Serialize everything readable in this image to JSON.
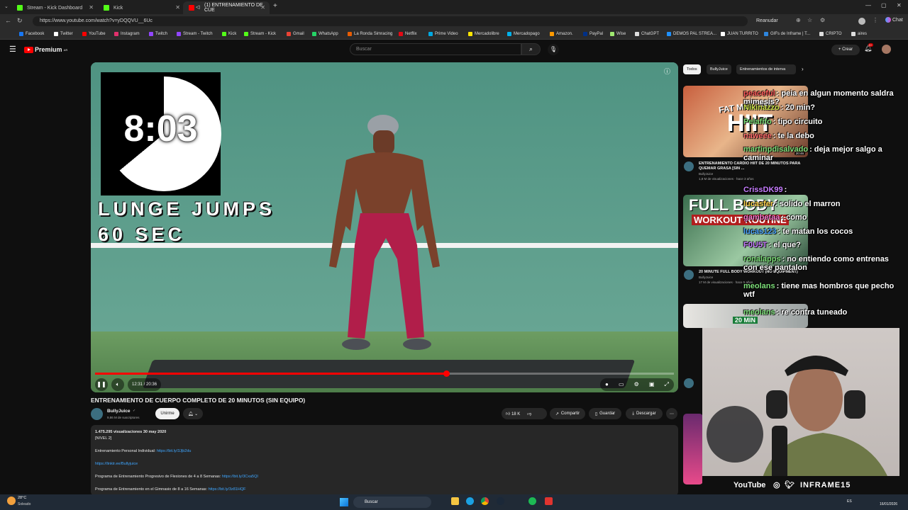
{
  "tabs": [
    {
      "label": "Stream - Kick Dashboard",
      "color": "#53fc18"
    },
    {
      "label": "Kick",
      "color": "#53fc18"
    },
    {
      "label": "(1) ENTRENAMIENTO DE CUE",
      "color": "#ff0000"
    }
  ],
  "address": {
    "url": "https://www.youtube.com/watch?v=yDQQVU__6Uc",
    "resume": "Reanudar",
    "chat": "Chat"
  },
  "bookmarks": [
    "Facebook",
    "Twitter",
    "YouTube",
    "Instagram",
    "Twitch",
    "Stream - Twitch",
    "Kick",
    "Stream - Kick",
    "Gmail",
    "WhatsApp",
    "La Ronda Simracing",
    "Netflix",
    "Prime Video",
    "Mercadolibre",
    "Mercadopago",
    "Amazon.",
    "PayPal",
    "Wise",
    "ChatGPT",
    "DEMOS PAL STREA...",
    "JUAN TURRITO",
    "GIFs de Inframe | T...",
    "CRIPTO",
    "aires"
  ],
  "yt": {
    "logo": "Premium",
    "logo_sup": "AR",
    "search_placeholder": "Buscar",
    "create": "Crear",
    "notif": "9+"
  },
  "player": {
    "timer": "8:03",
    "overlay1": "LUNGE JUMPS",
    "overlay2": "60 SEC",
    "time": "12:31 / 20:36",
    "progress": 0.607
  },
  "video": {
    "title": "ENTRENAMIENTO DE CUERPO COMPLETO DE 20 MINUTOS (SIN EQUIPO)",
    "channel": "BullyJuice",
    "subs": "9,86 M de suscriptores",
    "join": "Unirme",
    "likes": "18 K",
    "share": "Compartir",
    "save": "Guardar",
    "download": "Descargar",
    "views": "1.475.295 visualizaciones  30 may 2020",
    "level": "[NIVEL 2]",
    "desc_lines": [
      {
        "text": "Entrenamiento Personal Individual: ",
        "link": "https://bit.ly/3Jjb2du"
      },
      {
        "text": "",
        "link": "https://linktr.ee/Bullyjuice"
      },
      {
        "text": "Programa de Entrenamiento Progresivo de Flexiones de 4 a 8 Semanas: ",
        "link": "https://bit.ly/3Cxa5QI"
      },
      {
        "text": "Programa de Entrenamiento en el Gimnasio de 8 a 16 Semanas: ",
        "link": "https://bit.ly/3z81HQF"
      }
    ]
  },
  "sidebar": {
    "chips": [
      "Todos",
      "BullyJuice",
      "Entrenamientos de interva"
    ],
    "videos": [
      {
        "thumb_text": "HIIT",
        "thumb_sub": "FAT MELTING",
        "title": "ENTRENAMIENTO CARDIO HIIT DE 20 MINUTOS PARA QUEMAR GRASA [SIN ...",
        "channel": "BullyJuice",
        "meta": "1,8 M de visualizaciones · hace 3 años",
        "duration": "20:46"
      },
      {
        "thumb_text": "FULL BODY",
        "thumb_sub": "WORKOUT ROUTINE",
        "title": "20 MINUTE FULL BODY WORKOUT (NO EQUIPMENT)",
        "channel": "BullyJuice",
        "meta": "17 M de visualizaciones · hace 5 años",
        "duration": ""
      },
      {
        "thumb_text": "20 MIN",
        "thumb_sub": "",
        "title": "",
        "channel": "",
        "meta": "",
        "duration": ""
      }
    ]
  },
  "chat": [
    {
      "user": "peaceful",
      "msg": ": peia en algun momento saldra mimesis?",
      "color": "#ff5a5a"
    },
    {
      "user": "Nikinazzo",
      "msg": ": 20 min?",
      "color": "#c8e04a"
    },
    {
      "user": "Pelafifo",
      "msg": ": tipo circuito",
      "color": "#7ee07a"
    },
    {
      "user": "naweee",
      "msg": ": te la debo",
      "color": "#ff6a6a"
    },
    {
      "user": "martinpdisalvado",
      "msg": ": deja mejor salgo a caminar",
      "color": "#7ee07a"
    },
    {
      "user": "CrissDK99",
      "msg": ":",
      "color": "#c77dff"
    },
    {
      "user": "lucasfer",
      "msg": ": solido el marron",
      "color": "#ffd24a"
    },
    {
      "user": "gambetaa",
      "msg": ": como",
      "color": "#ff7ad0"
    },
    {
      "user": "lucas123",
      "msg": ": te matan los cocos",
      "color": "#4aa3ff"
    },
    {
      "user": "F0U5T",
      "msg": ": el que?",
      "color": "#c77dff"
    },
    {
      "user": "ronalapps",
      "msg": ": no entiendo como entrenas con ese pantalon",
      "color": "#7ee07a"
    },
    {
      "user": "meolans",
      "msg": ": tiene mas hombros que pecho wtf",
      "color": "#7ee07a"
    },
    {
      "user": "meolans",
      "msg": ": re contra tuneado",
      "color": "#7ee07a"
    }
  ],
  "cam": {
    "socials": "YouTube",
    "handle": "INFRAME15"
  },
  "taskbar": {
    "temp": "28°C",
    "weather": "Soleado",
    "search": "Buscar",
    "lang": "ES",
    "date": "16/01/2026"
  }
}
